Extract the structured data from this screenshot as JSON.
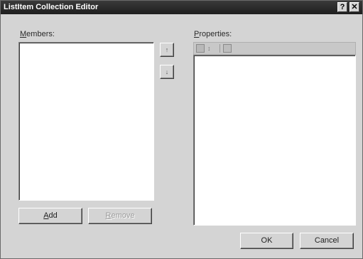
{
  "window": {
    "title": "ListItem Collection Editor",
    "help_glyph": "?",
    "close_glyph": "✕"
  },
  "members": {
    "label_prefix": "",
    "label_accel": "M",
    "label_rest": "embers:",
    "items": []
  },
  "order_buttons": {
    "up_glyph": "↑",
    "down_glyph": "↓"
  },
  "properties": {
    "label_accel": "P",
    "label_rest": "roperties:",
    "toolbar_icons": [
      "categorized-icon",
      "alphabetical-icon",
      "property-pages-icon"
    ]
  },
  "buttons": {
    "add_accel": "A",
    "add_rest": "dd",
    "remove_accel": "R",
    "remove_rest": "emove",
    "ok": "OK",
    "cancel": "Cancel"
  },
  "colors": {
    "titlebar": "#2a2a2a",
    "face": "#d4d4d4",
    "window": "#ffffff"
  }
}
